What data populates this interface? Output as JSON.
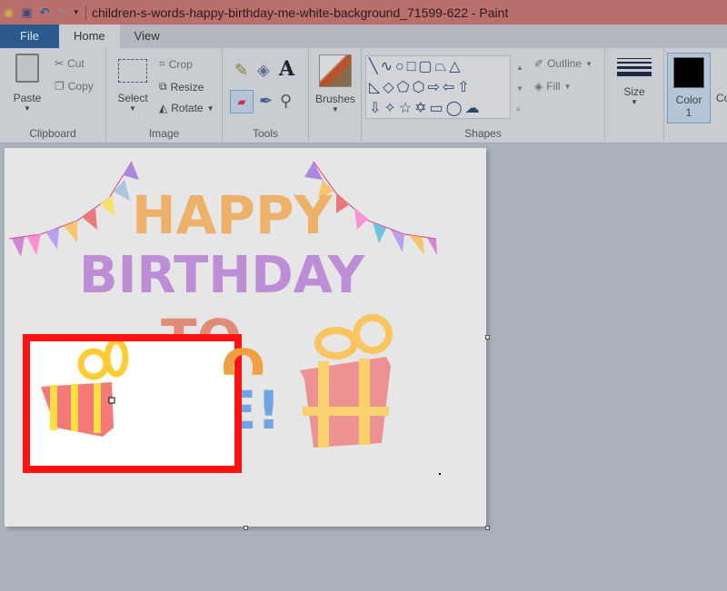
{
  "window": {
    "title": "children-s-words-happy-birthday-me-white-background_71599-622 - Paint"
  },
  "tabs": [
    {
      "label": "File"
    },
    {
      "label": "Home"
    },
    {
      "label": "View"
    }
  ],
  "ribbon": {
    "clipboard": {
      "label": "Clipboard",
      "paste": "Paste",
      "cut": "Cut",
      "copy": "Copy"
    },
    "image": {
      "label": "Image",
      "select": "Select",
      "crop": "Crop",
      "resize": "Resize",
      "rotate": "Rotate"
    },
    "tools": {
      "label": "Tools"
    },
    "brushes": {
      "label": "Brushes"
    },
    "shapes": {
      "label": "Shapes",
      "outline": "Outline",
      "fill": "Fill"
    },
    "size": {
      "label": "Size"
    },
    "color1": {
      "label": "Color",
      "num": "1",
      "value": "#000000"
    },
    "color2": {
      "label": "Co"
    }
  },
  "artwork": {
    "line1": "HAPPY",
    "line2": "BIRTHDAY",
    "line3": "TO",
    "line4": "ME!"
  },
  "highlight_color": "#ff1111"
}
